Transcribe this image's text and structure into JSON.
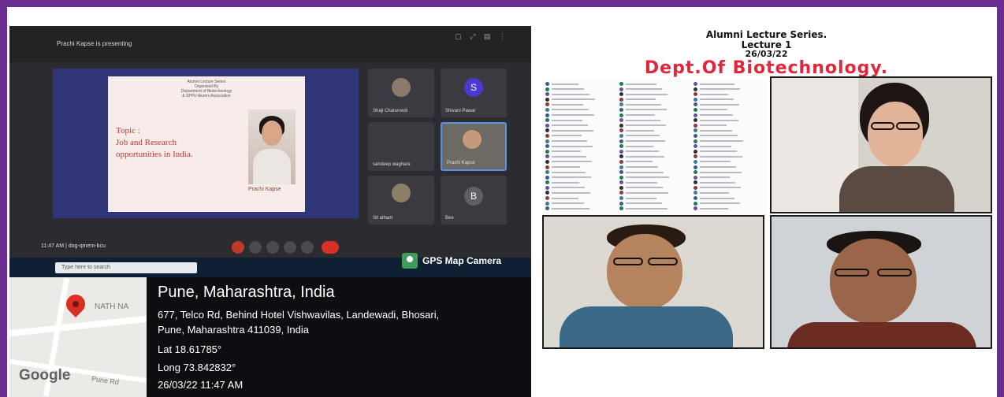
{
  "meeting": {
    "presenter_banner": "Prachi Kapse is presenting",
    "slide": {
      "series_title": "Alumni Lecture Series",
      "organized_by": "Organized By",
      "department": "Department of Biotechnology",
      "association": "& SPPU Alumni Association",
      "topic_line1": "Topic :",
      "topic_line2": "Job and Research",
      "topic_line3": "opportunities in India.",
      "speaker_name": "Prachi Kapse"
    },
    "participants": [
      {
        "name": "Shaji Chaturvedi"
      },
      {
        "name": "Shivani Pawar",
        "initial": "S"
      },
      {
        "name": "sandeep waghare"
      },
      {
        "name": "Prachi Kapse"
      },
      {
        "name": "Sit atham"
      },
      {
        "name": "Bee",
        "initial": "B"
      }
    ],
    "clock": "11:47 AM | dog-qmem-bcu",
    "taskbar_search": "Type here to search"
  },
  "gps": {
    "app_label": "GPS Map Camera",
    "map_label": "NATH NA",
    "map_brand": "Google",
    "map_road": "Pune Rd",
    "city": "Pune, Maharashtra, India",
    "address_line1": "677, Telco Rd, Behind Hotel Vishwavilas, Landewadi, Bhosari,",
    "address_line2": "Pune, Maharashtra 411039, India",
    "lat": "Lat 18.61785°",
    "long": "Long 73.842832°",
    "datetime": "26/03/22 11:47 AM"
  },
  "collage": {
    "title": "Alumni Lecture Series.",
    "lecture": "Lecture 1",
    "date": "26/03/22",
    "department": "Dept.Of Biotechnology."
  },
  "colors": {
    "frame": "#6a2c8e",
    "dept_red": "#e0283c",
    "end_call": "#d93025"
  }
}
